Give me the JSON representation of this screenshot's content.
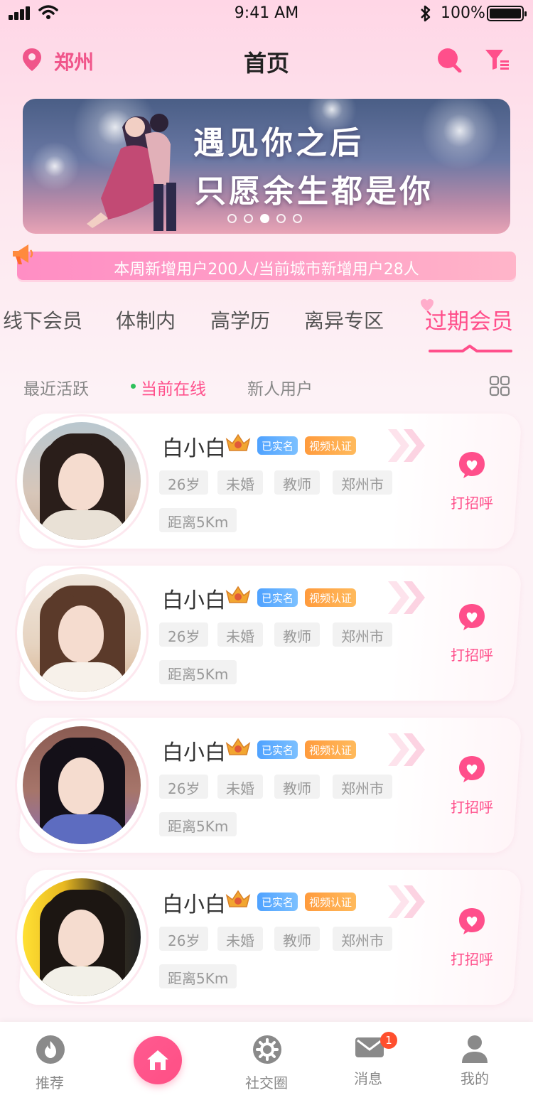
{
  "status_bar": {
    "time": "9:41 AM",
    "battery": "100%"
  },
  "header": {
    "city": "郑州",
    "title": "首页"
  },
  "banner": {
    "line1": "遇见你之后",
    "line2": "只愿余生都是你",
    "dot_count": 5,
    "active_dot": 3
  },
  "notice": {
    "text": "本周新增用户200人/当前城市新增用户28人"
  },
  "category_tabs": [
    {
      "label": "线下会员"
    },
    {
      "label": "体制内"
    },
    {
      "label": "高学历"
    },
    {
      "label": "离异专区"
    },
    {
      "label": "过期会员",
      "active": true
    }
  ],
  "sub_tabs": [
    {
      "label": "最近活跃"
    },
    {
      "label": "当前在线",
      "active": true
    },
    {
      "label": "新人用户"
    }
  ],
  "cards": [
    {
      "name": "白小白",
      "real_badge": "已实名",
      "video_badge": "视频认证",
      "age": "26岁",
      "marital": "未婚",
      "job": "教师",
      "city": "郑州市",
      "distance": "距离5Km",
      "greet": "打招呼"
    },
    {
      "name": "白小白",
      "real_badge": "已实名",
      "video_badge": "视频认证",
      "age": "26岁",
      "marital": "未婚",
      "job": "教师",
      "city": "郑州市",
      "distance": "距离5Km",
      "greet": "打招呼"
    },
    {
      "name": "白小白",
      "real_badge": "已实名",
      "video_badge": "视频认证",
      "age": "26岁",
      "marital": "未婚",
      "job": "教师",
      "city": "郑州市",
      "distance": "距离5Km",
      "greet": "打招呼"
    },
    {
      "name": "白小白",
      "real_badge": "已实名",
      "video_badge": "视频认证",
      "age": "26岁",
      "marital": "未婚",
      "job": "教师",
      "city": "郑州市",
      "distance": "距离5Km",
      "greet": "打招呼"
    }
  ],
  "bottom_nav": [
    {
      "label": "推荐",
      "icon": "flame-icon"
    },
    {
      "label": "",
      "icon": "home-icon",
      "active": true
    },
    {
      "label": "社交圈",
      "icon": "gear-icon"
    },
    {
      "label": "消息",
      "icon": "mail-icon",
      "badge": "1"
    },
    {
      "label": "我的",
      "icon": "user-icon"
    }
  ],
  "colors": {
    "accent": "#ff4f8b",
    "accent_light": "#ffd6e6",
    "real_badge": "#4fa2ff",
    "video_badge": "#ff9b3d"
  }
}
